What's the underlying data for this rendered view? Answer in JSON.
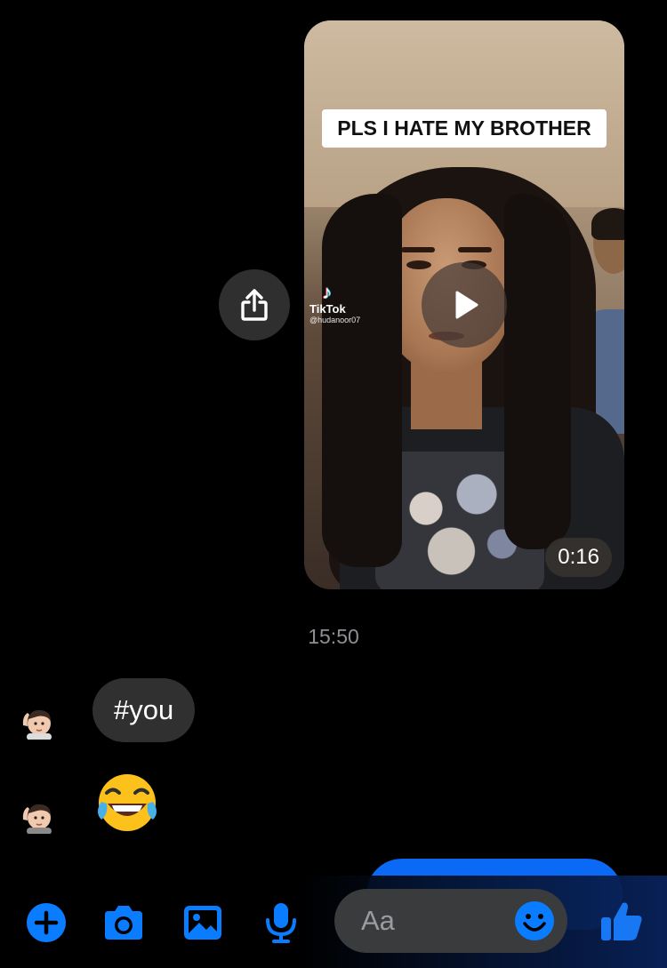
{
  "video": {
    "caption": "PLS I HATE MY BROTHER",
    "source_brand": "TikTok",
    "source_handle": "@hudanoor07",
    "duration": "0:16"
  },
  "timestamp": "15:50",
  "messages": [
    {
      "type": "text",
      "text": "#you"
    },
    {
      "type": "emoji",
      "emoji": "face-with-tears-of-joy"
    }
  ],
  "composer": {
    "placeholder": "Aa",
    "tools": [
      "plus-icon",
      "camera-icon",
      "photo-icon",
      "mic-icon"
    ],
    "accent_color": "#0a7cff"
  },
  "colors": {
    "background": "#000000",
    "incoming_bubble": "#303030",
    "outgoing_bubble": "#0a6af5"
  }
}
